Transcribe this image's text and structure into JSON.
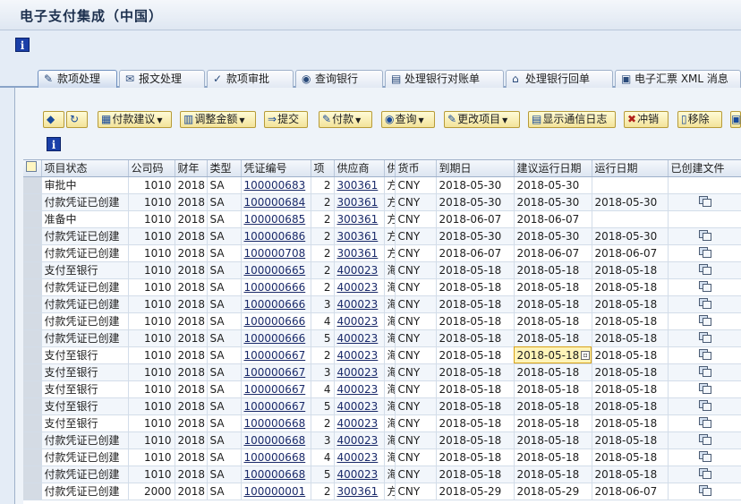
{
  "window": {
    "title": "电子支付集成（中国）"
  },
  "tabs": [
    {
      "label": "款项处理",
      "icon": "money-icon"
    },
    {
      "label": "报文处理",
      "icon": "message-icon"
    },
    {
      "label": "款项审批",
      "icon": "approve-icon"
    },
    {
      "label": "查询银行",
      "icon": "bank-query-icon"
    },
    {
      "label": "处理银行对账单",
      "icon": "statement-icon"
    },
    {
      "label": "处理银行回单",
      "icon": "receipt-icon"
    },
    {
      "label": "电子汇票 XML 消息",
      "icon": "xml-icon"
    }
  ],
  "toolbar": {
    "pay_proposal": "付款建议",
    "adjust_amount": "调整金额",
    "submit": "提交",
    "pay": "付款",
    "query": "查询",
    "change_item": "更改项目",
    "show_comm_log": "显示通信日志",
    "reverse": "冲销",
    "remove": "移除"
  },
  "grid": {
    "columns": [
      "项目状态",
      "公司码",
      "财年",
      "类型",
      "凭证编号",
      "项",
      "供应商",
      "供",
      "货币",
      "到期日",
      "建议运行日期",
      "运行日期",
      "已创建文件"
    ],
    "rows": [
      {
        "status": "审批中",
        "company": "1010",
        "year": "2018",
        "type": "SA",
        "doc": "100000683",
        "item": "2",
        "vendor": "300361",
        "v": "方",
        "cur": "CNY",
        "due": "2018-05-30",
        "proposed": "2018-05-30",
        "run": "",
        "file": false
      },
      {
        "status": "付款凭证已创建",
        "company": "1010",
        "year": "2018",
        "type": "SA",
        "doc": "100000684",
        "item": "2",
        "vendor": "300361",
        "v": "方",
        "cur": "CNY",
        "due": "2018-05-30",
        "proposed": "2018-05-30",
        "run": "2018-05-30",
        "file": true
      },
      {
        "status": "准备中",
        "company": "1010",
        "year": "2018",
        "type": "SA",
        "doc": "100000685",
        "item": "2",
        "vendor": "300361",
        "v": "方",
        "cur": "CNY",
        "due": "2018-06-07",
        "proposed": "2018-06-07",
        "run": "",
        "file": false
      },
      {
        "status": "付款凭证已创建",
        "company": "1010",
        "year": "2018",
        "type": "SA",
        "doc": "100000686",
        "item": "2",
        "vendor": "300361",
        "v": "方",
        "cur": "CNY",
        "due": "2018-05-30",
        "proposed": "2018-05-30",
        "run": "2018-05-30",
        "file": true
      },
      {
        "status": "付款凭证已创建",
        "company": "1010",
        "year": "2018",
        "type": "SA",
        "doc": "100000708",
        "item": "2",
        "vendor": "300361",
        "v": "方",
        "cur": "CNY",
        "due": "2018-06-07",
        "proposed": "2018-06-07",
        "run": "2018-06-07",
        "file": true
      },
      {
        "status": "支付至银行",
        "company": "1010",
        "year": "2018",
        "type": "SA",
        "doc": "100000665",
        "item": "2",
        "vendor": "400023",
        "v": "海",
        "cur": "CNY",
        "due": "2018-05-18",
        "proposed": "2018-05-18",
        "run": "2018-05-18",
        "file": true
      },
      {
        "status": "付款凭证已创建",
        "company": "1010",
        "year": "2018",
        "type": "SA",
        "doc": "100000666",
        "item": "2",
        "vendor": "400023",
        "v": "海",
        "cur": "CNY",
        "due": "2018-05-18",
        "proposed": "2018-05-18",
        "run": "2018-05-18",
        "file": true
      },
      {
        "status": "付款凭证已创建",
        "company": "1010",
        "year": "2018",
        "type": "SA",
        "doc": "100000666",
        "item": "3",
        "vendor": "400023",
        "v": "海",
        "cur": "CNY",
        "due": "2018-05-18",
        "proposed": "2018-05-18",
        "run": "2018-05-18",
        "file": true
      },
      {
        "status": "付款凭证已创建",
        "company": "1010",
        "year": "2018",
        "type": "SA",
        "doc": "100000666",
        "item": "4",
        "vendor": "400023",
        "v": "海",
        "cur": "CNY",
        "due": "2018-05-18",
        "proposed": "2018-05-18",
        "run": "2018-05-18",
        "file": true
      },
      {
        "status": "付款凭证已创建",
        "company": "1010",
        "year": "2018",
        "type": "SA",
        "doc": "100000666",
        "item": "5",
        "vendor": "400023",
        "v": "海",
        "cur": "CNY",
        "due": "2018-05-18",
        "proposed": "2018-05-18",
        "run": "2018-05-18",
        "file": true
      },
      {
        "status": "支付至银行",
        "company": "1010",
        "year": "2018",
        "type": "SA",
        "doc": "100000667",
        "item": "2",
        "vendor": "400023",
        "v": "海",
        "cur": "CNY",
        "due": "2018-05-18",
        "proposed": "2018-05-18",
        "run": "2018-05-18",
        "file": true,
        "highlight": true
      },
      {
        "status": "支付至银行",
        "company": "1010",
        "year": "2018",
        "type": "SA",
        "doc": "100000667",
        "item": "3",
        "vendor": "400023",
        "v": "海",
        "cur": "CNY",
        "due": "2018-05-18",
        "proposed": "2018-05-18",
        "run": "2018-05-18",
        "file": true
      },
      {
        "status": "支付至银行",
        "company": "1010",
        "year": "2018",
        "type": "SA",
        "doc": "100000667",
        "item": "4",
        "vendor": "400023",
        "v": "海",
        "cur": "CNY",
        "due": "2018-05-18",
        "proposed": "2018-05-18",
        "run": "2018-05-18",
        "file": true
      },
      {
        "status": "支付至银行",
        "company": "1010",
        "year": "2018",
        "type": "SA",
        "doc": "100000667",
        "item": "5",
        "vendor": "400023",
        "v": "海",
        "cur": "CNY",
        "due": "2018-05-18",
        "proposed": "2018-05-18",
        "run": "2018-05-18",
        "file": true
      },
      {
        "status": "支付至银行",
        "company": "1010",
        "year": "2018",
        "type": "SA",
        "doc": "100000668",
        "item": "2",
        "vendor": "400023",
        "v": "海",
        "cur": "CNY",
        "due": "2018-05-18",
        "proposed": "2018-05-18",
        "run": "2018-05-18",
        "file": true
      },
      {
        "status": "付款凭证已创建",
        "company": "1010",
        "year": "2018",
        "type": "SA",
        "doc": "100000668",
        "item": "3",
        "vendor": "400023",
        "v": "海",
        "cur": "CNY",
        "due": "2018-05-18",
        "proposed": "2018-05-18",
        "run": "2018-05-18",
        "file": true
      },
      {
        "status": "付款凭证已创建",
        "company": "1010",
        "year": "2018",
        "type": "SA",
        "doc": "100000668",
        "item": "4",
        "vendor": "400023",
        "v": "海",
        "cur": "CNY",
        "due": "2018-05-18",
        "proposed": "2018-05-18",
        "run": "2018-05-18",
        "file": true
      },
      {
        "status": "付款凭证已创建",
        "company": "1010",
        "year": "2018",
        "type": "SA",
        "doc": "100000668",
        "item": "5",
        "vendor": "400023",
        "v": "海",
        "cur": "CNY",
        "due": "2018-05-18",
        "proposed": "2018-05-18",
        "run": "2018-05-18",
        "file": true
      },
      {
        "status": "付款凭证已创建",
        "company": "2000",
        "year": "2018",
        "type": "SA",
        "doc": "100000001",
        "item": "2",
        "vendor": "300361",
        "v": "方",
        "cur": "CNY",
        "due": "2018-05-29",
        "proposed": "2018-05-29",
        "run": "2018-06-07",
        "file": true
      }
    ]
  }
}
